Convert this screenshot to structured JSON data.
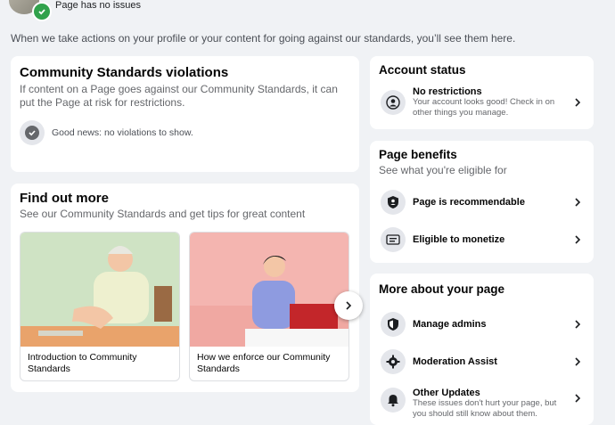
{
  "header": {
    "status_text": "Page has no issues",
    "intro": "When we take actions on your profile or your content for going against our standards, you’ll see them here."
  },
  "violations": {
    "title": "Community Standards violations",
    "description": "If content on a Page goes against our Community Standards, it can put the Page at risk for restrictions.",
    "status": "Good news: no violations to show."
  },
  "find_out_more": {
    "title": "Find out more",
    "subtitle": "See our Community Standards and get tips for great content",
    "items": [
      {
        "caption": "Introduction to Community Standards",
        "illustration": "older-man-at-desk"
      },
      {
        "caption": "How we enforce our Community Standards",
        "illustration": "woman-on-laptop"
      }
    ]
  },
  "account_status": {
    "title": "Account status",
    "items": [
      {
        "title": "No restrictions",
        "desc": "Your account looks good! Check in on other things you manage.",
        "icon": "person-circle-icon"
      }
    ]
  },
  "page_benefits": {
    "title": "Page benefits",
    "subtitle": "See what you're eligible for",
    "items": [
      {
        "title": "Page is recommendable",
        "icon": "shield-person-icon"
      },
      {
        "title": "Eligible to monetize",
        "icon": "money-icon"
      }
    ]
  },
  "more_about": {
    "title": "More about your page",
    "items": [
      {
        "title": "Manage admins",
        "icon": "shield-icon"
      },
      {
        "title": "Moderation Assist",
        "icon": "gear-icon"
      },
      {
        "title": "Other Updates",
        "desc": "These issues don't hurt your page, but you should still know about them.",
        "icon": "bell-icon"
      }
    ]
  },
  "colors": {
    "background": "#f0f2f5",
    "check_green": "#31a24c",
    "card": "#ffffff"
  }
}
